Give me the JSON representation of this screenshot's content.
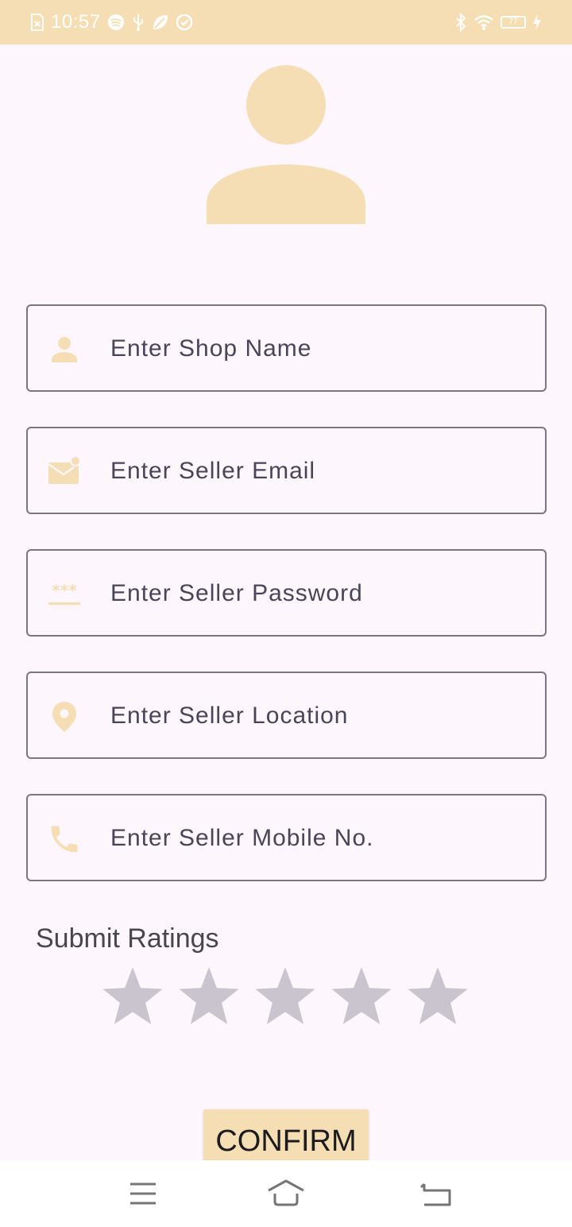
{
  "status_bar": {
    "time": "10:57",
    "battery": "77",
    "icons_left": [
      "sim-icon",
      "spotify-icon",
      "usb-icon",
      "leaf-icon",
      "sync-icon"
    ],
    "icons_right": [
      "bluetooth-icon",
      "wifi-icon",
      "battery-icon",
      "charging-icon"
    ]
  },
  "colors": {
    "accent": "#F5DEB3",
    "background": "#FDF6FD",
    "field_border": "#7A757F",
    "text": "#4A4458",
    "star_inactive": "#CAC4CF"
  },
  "form": {
    "fields": [
      {
        "icon": "person-icon",
        "placeholder": "Enter Shop Name",
        "value": ""
      },
      {
        "icon": "email-icon",
        "placeholder": "Enter Seller Email",
        "value": ""
      },
      {
        "icon": "password-icon",
        "placeholder": "Enter Seller Password",
        "value": ""
      },
      {
        "icon": "location-icon",
        "placeholder": "Enter Seller Location",
        "value": ""
      },
      {
        "icon": "phone-icon",
        "placeholder": "Enter Seller Mobile No.",
        "value": ""
      }
    ]
  },
  "ratings": {
    "title": "Submit Ratings",
    "max": 5,
    "value": 0
  },
  "confirm_button": {
    "label": "CONFIRM"
  },
  "nav_bar": {
    "buttons": [
      "menu-icon",
      "home-icon",
      "back-icon"
    ]
  }
}
